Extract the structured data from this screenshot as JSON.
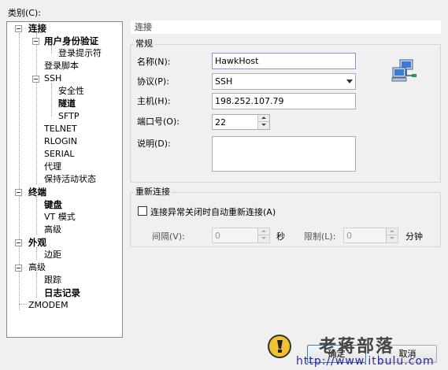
{
  "category_label": "类别(C):",
  "tree": {
    "connection": "连接",
    "user_auth": "用户身份验证",
    "login_prompts": "登录提示符",
    "login_script": "登录脚本",
    "ssh": "SSH",
    "security": "安全性",
    "tunnel": "隧道",
    "sftp": "SFTP",
    "telnet": "TELNET",
    "rlogin": "RLOGIN",
    "serial": "SERIAL",
    "proxy": "代理",
    "keepalive": "保持活动状态",
    "terminal": "终端",
    "keyboard": "键盘",
    "vt_mode": "VT 模式",
    "terminal_advanced": "高级",
    "appearance": "外观",
    "margins": "边距",
    "advanced": "高级",
    "trace": "跟踪",
    "logging": "日志记录",
    "zmodem": "ZMODEM"
  },
  "panel": {
    "header": "连接",
    "general_group": "常规",
    "name_label": "名称(N):",
    "name_value": "HawkHost",
    "protocol_label": "协议(P):",
    "protocol_value": "SSH",
    "host_label": "主机(H):",
    "host_value": "198.252.107.79",
    "port_label": "端口号(O):",
    "port_value": "22",
    "desc_label": "说明(D):",
    "desc_value": "",
    "reconnect_group": "重新连接",
    "reconnect_checkbox": "连接异常关闭时自动重新连接(A)",
    "interval_label": "间隔(V):",
    "interval_value": "0",
    "seconds": "秒",
    "limit_label": "限制(L):",
    "limit_value": "0",
    "minutes": "分钟"
  },
  "buttons": {
    "ok": "确定",
    "cancel": "取消"
  },
  "watermark": {
    "text": "老蒋部落",
    "url": "http://www.itbulu.com"
  }
}
